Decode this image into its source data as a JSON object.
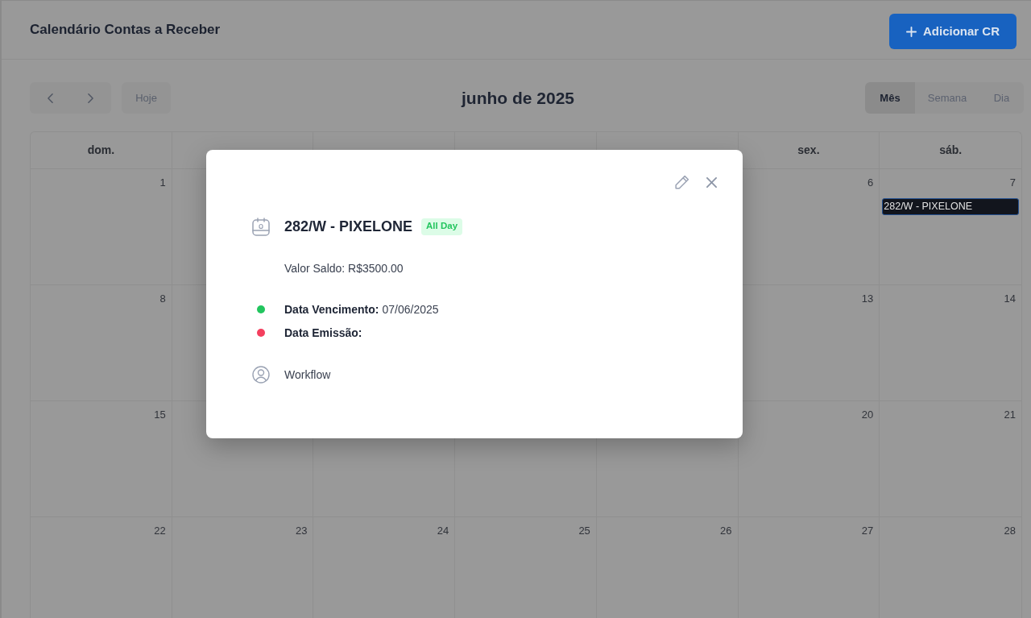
{
  "header": {
    "title": "Calendário Contas a Receber",
    "add_button": {
      "label": "Adicionar CR"
    }
  },
  "toolbar": {
    "today_button": {
      "label": "Hoje"
    },
    "period_title": "junho de 2025",
    "views": [
      {
        "label": "Mês",
        "selected": true
      },
      {
        "label": "Semana",
        "selected": false
      },
      {
        "label": "Dia",
        "selected": false
      }
    ]
  },
  "calendar": {
    "weekdays": {
      "column_1": "dom.",
      "column_6": "sex.",
      "column_7": "sáb."
    },
    "weeks": [
      {
        "column_1": {
          "day": "1"
        },
        "column_6": {
          "day": "6"
        },
        "column_7": {
          "day": "7",
          "events": [
            {
              "title": "282/W - PIXELONE"
            }
          ]
        }
      },
      {
        "column_1": {
          "day": "8"
        },
        "column_6": {
          "day": "13"
        },
        "column_7": {
          "day": "14"
        }
      },
      {
        "column_1": {
          "day": "15"
        },
        "column_6": {
          "day": "20"
        },
        "column_7": {
          "day": "21"
        }
      },
      {
        "column_1": {
          "day": "22"
        },
        "column_2": {
          "day": "23"
        },
        "column_3": {
          "day": "24"
        },
        "column_4": {
          "day": "25"
        },
        "column_5": {
          "day": "26"
        },
        "column_6": {
          "day": "27"
        },
        "column_7": {
          "day": "28"
        }
      }
    ]
  },
  "event_popup": {
    "title": "282/W - PIXELONE",
    "badge": "All Day",
    "balance": "Valor Saldo: R$3500.00",
    "dates": [
      {
        "label": "Data Vencimento:",
        "value": "07/06/2025",
        "color": "#22c55e"
      },
      {
        "label": "Data Emissão:",
        "color": "#f43f5e"
      }
    ],
    "owner": "Workflow"
  }
}
